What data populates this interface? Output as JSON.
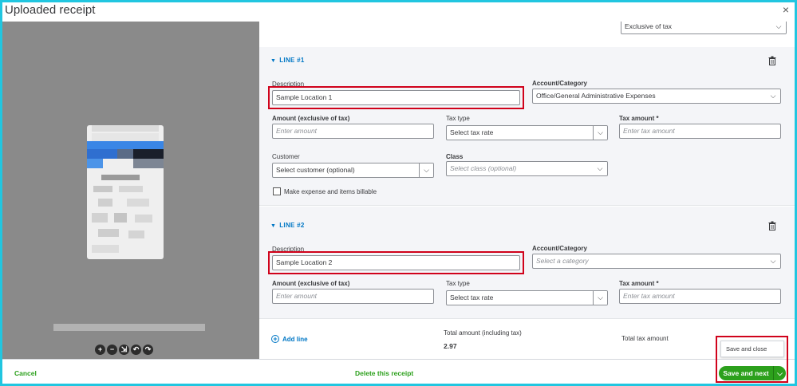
{
  "dialog": {
    "title": "Uploaded receipt",
    "close_symbol": "×"
  },
  "form": {
    "tax_mode": "Exclusive of tax",
    "lines": [
      {
        "heading": "LINE #1",
        "description_label": "Description",
        "description_value": "Sample Location 1",
        "account_label": "Account/Category",
        "account_value": "Office/General Administrative Expenses",
        "amount_label": "Amount (exclusive of tax)",
        "amount_placeholder": "Enter amount",
        "tax_type_label": "Tax type",
        "tax_type_value": "Select tax rate",
        "tax_amount_label": "Tax amount *",
        "tax_amount_placeholder": "Enter tax amount",
        "customer_label": "Customer",
        "customer_value": "Select customer (optional)",
        "class_label": "Class",
        "class_placeholder": "Select class (optional)",
        "billable_label": "Make expense and items billable"
      },
      {
        "heading": "LINE #2",
        "description_label": "Description",
        "description_value": "Sample Location 2",
        "account_label": "Account/Category",
        "account_placeholder": "Select a category",
        "amount_label": "Amount (exclusive of tax)",
        "amount_placeholder": "Enter amount",
        "tax_type_label": "Tax type",
        "tax_type_value": "Select tax rate",
        "tax_amount_label": "Tax amount *",
        "tax_amount_placeholder": "Enter tax amount"
      }
    ],
    "add_line": "Add line",
    "total_label": "Total amount (including tax)",
    "total_value": "2.97",
    "total_tax_label": "Total tax amount"
  },
  "footer": {
    "cancel": "Cancel",
    "delete": "Delete this receipt",
    "save_and_next": "Save and next",
    "save_and_close": "Save and close"
  },
  "colors": {
    "accent_green": "#2ca01c",
    "link_blue": "#0077c5",
    "highlight_red": "#d0021b",
    "frame_cyan": "#21c6e0"
  }
}
